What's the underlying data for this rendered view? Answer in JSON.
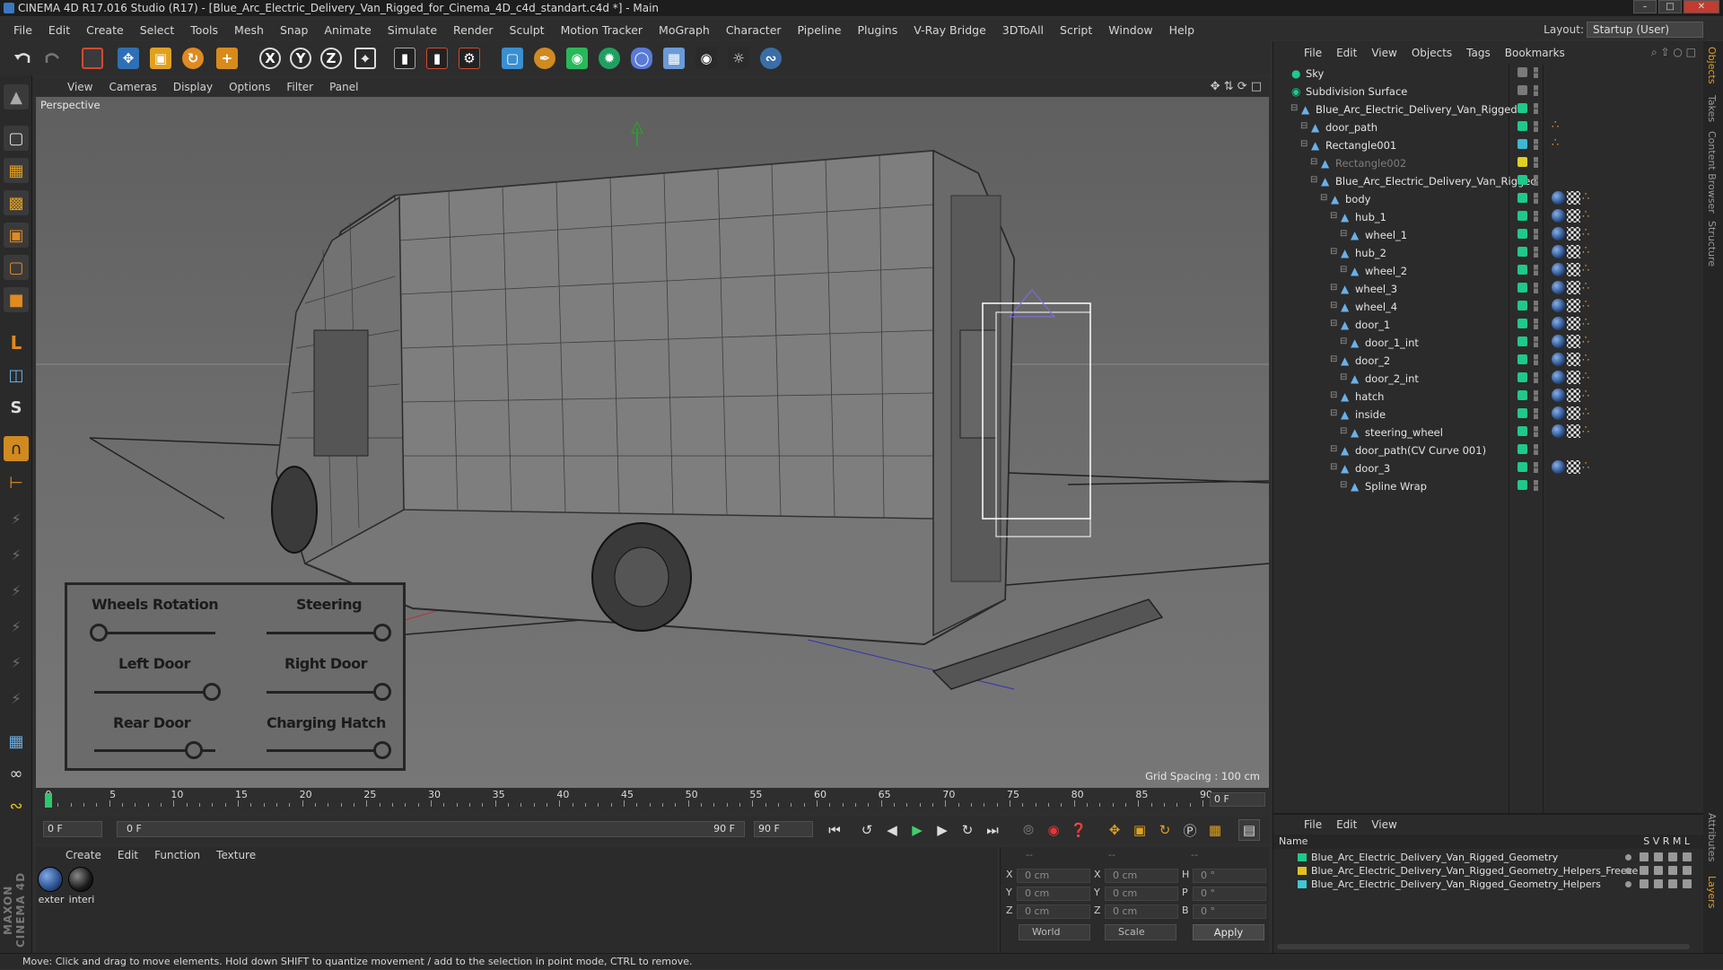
{
  "window": {
    "title": "CINEMA 4D R17.016 Studio (R17) - [Blue_Arc_Electric_Delivery_Van_Rigged_for_Cinema_4D_c4d_standart.c4d *] - Main"
  },
  "menubar": {
    "items": [
      "File",
      "Edit",
      "Create",
      "Select",
      "Tools",
      "Mesh",
      "Snap",
      "Animate",
      "Simulate",
      "Render",
      "Sculpt",
      "Motion Tracker",
      "MoGraph",
      "Character",
      "Pipeline",
      "Plugins",
      "V-Ray Bridge",
      "3DToAll",
      "Script",
      "Window",
      "Help"
    ],
    "layout_label": "Layout:",
    "layout_value": "Startup (User)"
  },
  "toolbar": {
    "axis_x": "X",
    "axis_y": "Y",
    "axis_z": "Z"
  },
  "viewport": {
    "menu": [
      "View",
      "Cameras",
      "Display",
      "Options",
      "Filter",
      "Panel"
    ],
    "label": "Perspective",
    "grid_spacing": "Grid Spacing : 100 cm",
    "controls": {
      "wheels_rotation": "Wheels Rotation",
      "steering": "Steering",
      "left_door": "Left Door",
      "right_door": "Right Door",
      "rear_door": "Rear Door",
      "charging_hatch": "Charging Hatch"
    }
  },
  "timeline": {
    "ticks": [
      "0",
      "5",
      "10",
      "15",
      "20",
      "25",
      "30",
      "35",
      "40",
      "45",
      "50",
      "55",
      "60",
      "65",
      "70",
      "75",
      "80",
      "85",
      "90"
    ],
    "current_frame": "0 F",
    "start_field": "0 F",
    "range_start": "0 F",
    "range_end": "90 F",
    "end_field": "90 F"
  },
  "materials": {
    "menu": [
      "Create",
      "Edit",
      "Function",
      "Texture"
    ],
    "items": [
      {
        "label": "exter",
        "color": "#2a4f8a"
      },
      {
        "label": "interi",
        "color": "#1a1a1a"
      }
    ]
  },
  "coordinates": {
    "header_a": "--",
    "header_b": "--",
    "header_c": "--",
    "rows": [
      {
        "l1": "X",
        "v1": "0 cm",
        "l2": "X",
        "v2": "0 cm",
        "l3": "H",
        "v3": "0 °"
      },
      {
        "l1": "Y",
        "v1": "0 cm",
        "l2": "Y",
        "v2": "0 cm",
        "l3": "P",
        "v3": "0 °"
      },
      {
        "l1": "Z",
        "v1": "0 cm",
        "l2": "Z",
        "v2": "0 cm",
        "l3": "B",
        "v3": "0 °"
      }
    ],
    "mode_world": "World",
    "mode_scale": "Scale",
    "apply": "Apply"
  },
  "objects": {
    "menu": [
      "File",
      "Edit",
      "View",
      "Objects",
      "Tags",
      "Bookmarks"
    ],
    "rows": [
      {
        "name": "Sky",
        "indent": 0,
        "vis": "#7a7a7a",
        "tags": []
      },
      {
        "name": "Subdivision Surface",
        "indent": 0,
        "vis": "#7a7a7a",
        "tags": []
      },
      {
        "name": "Blue_Arc_Electric_Delivery_Van_Rigged",
        "indent": 1,
        "vis": "#1ec98a",
        "tags": []
      },
      {
        "name": "door_path",
        "indent": 2,
        "vis": "#1ec98a",
        "tags": [
          "o"
        ]
      },
      {
        "name": "Rectangle001",
        "indent": 2,
        "vis": "#3fb7d3",
        "tags": [
          "o"
        ]
      },
      {
        "name": "Rectangle002",
        "indent": 3,
        "vis": "#e0d020",
        "tags": [],
        "dim": true
      },
      {
        "name": "Blue_Arc_Electric_Delivery_Van_Rigged",
        "indent": 3,
        "vis": "#1ec98a",
        "tags": []
      },
      {
        "name": "body",
        "indent": 4,
        "vis": "#1ec98a",
        "tags": [
          "m",
          "c",
          "o"
        ]
      },
      {
        "name": "hub_1",
        "indent": 5,
        "vis": "#1ec98a",
        "tags": [
          "m",
          "c",
          "o"
        ]
      },
      {
        "name": "wheel_1",
        "indent": 6,
        "vis": "#1ec98a",
        "tags": [
          "m",
          "c",
          "o"
        ]
      },
      {
        "name": "hub_2",
        "indent": 5,
        "vis": "#1ec98a",
        "tags": [
          "m",
          "c",
          "o"
        ]
      },
      {
        "name": "wheel_2",
        "indent": 6,
        "vis": "#1ec98a",
        "tags": [
          "m",
          "c",
          "o"
        ]
      },
      {
        "name": "wheel_3",
        "indent": 5,
        "vis": "#1ec98a",
        "tags": [
          "m",
          "c",
          "o"
        ]
      },
      {
        "name": "wheel_4",
        "indent": 5,
        "vis": "#1ec98a",
        "tags": [
          "m",
          "c",
          "o"
        ]
      },
      {
        "name": "door_1",
        "indent": 5,
        "vis": "#1ec98a",
        "tags": [
          "m",
          "c",
          "o"
        ]
      },
      {
        "name": "door_1_int",
        "indent": 6,
        "vis": "#1ec98a",
        "tags": [
          "m",
          "c",
          "o"
        ]
      },
      {
        "name": "door_2",
        "indent": 5,
        "vis": "#1ec98a",
        "tags": [
          "m",
          "c",
          "o"
        ]
      },
      {
        "name": "door_2_int",
        "indent": 6,
        "vis": "#1ec98a",
        "tags": [
          "m",
          "c",
          "o"
        ]
      },
      {
        "name": "hatch",
        "indent": 5,
        "vis": "#1ec98a",
        "tags": [
          "m",
          "c",
          "o"
        ]
      },
      {
        "name": "inside",
        "indent": 5,
        "vis": "#1ec98a",
        "tags": [
          "m",
          "c",
          "o"
        ]
      },
      {
        "name": "steering_wheel",
        "indent": 6,
        "vis": "#1ec98a",
        "tags": [
          "m",
          "c",
          "o"
        ]
      },
      {
        "name": "door_path(CV Curve 001)",
        "indent": 5,
        "vis": "#1ec98a",
        "tags": []
      },
      {
        "name": "door_3",
        "indent": 5,
        "vis": "#1ec98a",
        "tags": [
          "m",
          "c",
          "o"
        ]
      },
      {
        "name": "Spline Wrap",
        "indent": 6,
        "vis": "#1ec98a",
        "tags": []
      }
    ]
  },
  "layers": {
    "menu": [
      "File",
      "Edit",
      "View"
    ],
    "col_name": "Name",
    "col_flags": "S  V  R  M  L",
    "rows": [
      {
        "name": "Blue_Arc_Electric_Delivery_Van_Rigged_Geometry",
        "color": "#1ec98a"
      },
      {
        "name": "Blue_Arc_Electric_Delivery_Van_Rigged_Geometry_Helpers_Freeze",
        "color": "#e0c020"
      },
      {
        "name": "Blue_Arc_Electric_Delivery_Van_Rigged_Geometry_Helpers",
        "color": "#3fc7d3"
      }
    ]
  },
  "right_tabs": [
    "Objects",
    "Takes",
    "Content Browser",
    "Structure",
    "Attributes",
    "Layers"
  ],
  "status": {
    "text": "Move: Click and drag to move elements. Hold down SHIFT to quantize movement / add to the selection in point mode, CTRL to remove."
  }
}
